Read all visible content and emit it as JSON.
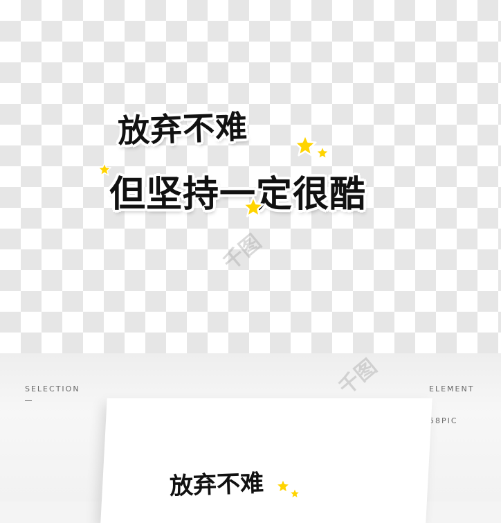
{
  "artwork": {
    "line1": "放弃不难",
    "line2": "但坚持一定很酷",
    "text_color": "#111111",
    "outline_color": "#ffffff",
    "star_color": "#ffd400"
  },
  "mockup": {
    "left_label": "SELECTION",
    "left_dash": "—",
    "right_label_1": "ELEMENT",
    "right_label_2": "/",
    "right_label_3": "58PIC",
    "card_text": "放弃不难"
  },
  "watermark": {
    "text": "千图"
  }
}
